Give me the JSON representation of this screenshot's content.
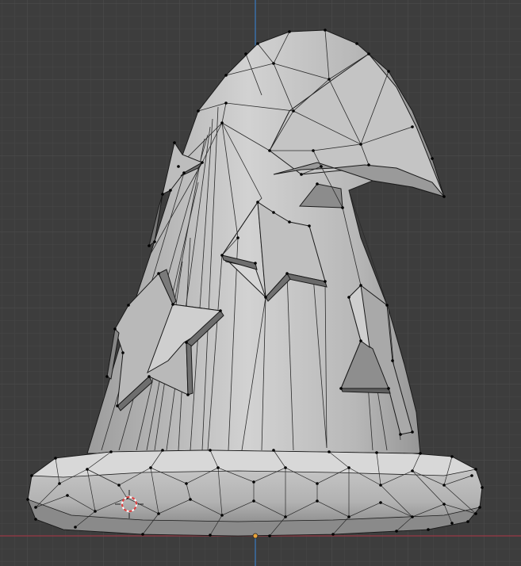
{
  "app": "3D viewport",
  "viewport": {
    "background": "#3d3d3d",
    "grid_minor_color": "#444444",
    "grid_major_color": "#4a4a4a",
    "x_axis_color": "#8a3a44",
    "z_axis_color": "#3a6ea8"
  },
  "mesh": {
    "object": "wizard-hat",
    "mode": "edit",
    "face_light": "#c9c9c9",
    "face_mid": "#a9a9a9",
    "face_dark": "#7f7f7f",
    "edge_color": "#1a1a1a",
    "vertex_color": "#000000"
  },
  "cursor_3d": {
    "icon": "3d-cursor-icon",
    "ring_colors": [
      "#e04040",
      "#ffffff"
    ]
  },
  "origin_marker": {
    "icon": "object-origin-icon",
    "color": "#e8a23a"
  }
}
